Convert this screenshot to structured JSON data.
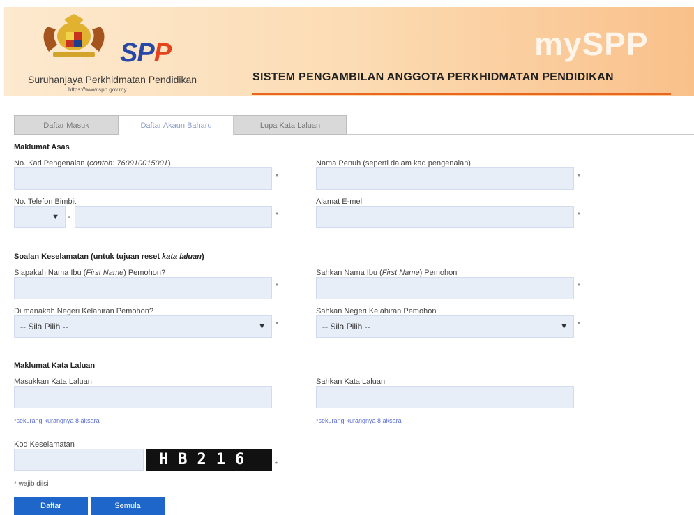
{
  "header": {
    "logo_text_a": "SP",
    "logo_text_b": "P",
    "org_name": "Suruhanjaya Perkhidmatan Pendidikan",
    "org_url": "https://www.spp.gov.my",
    "app_name": "mySPP",
    "system_title": "SISTEM PENGAMBILAN ANGGOTA PERKHIDMATAN PENDIDIKAN"
  },
  "tabs": [
    {
      "label": "Daftar Masuk"
    },
    {
      "label": "Daftar Akaun Baharu"
    },
    {
      "label": "Lupa Kata Laluan"
    }
  ],
  "basic": {
    "title": "Maklumat Asas",
    "ic_label": "No. Kad Pengenalan (",
    "ic_label_example": "contoh: 760910015001",
    "ic_label_end": ")",
    "fullname_label": "Nama Penuh (seperti dalam kad pengenalan)",
    "phone_label": "No. Telefon Bimbit",
    "phone_dash": "-",
    "email_label": "Alamat E-mel"
  },
  "security": {
    "title_a": "Soalan Keselamatan (untuk tujuan reset ",
    "title_b": "kata laluan",
    "title_c": ")",
    "mother_label_a": "Siapakah Nama Ibu (",
    "mother_label_b": "First Name",
    "mother_label_c": ") Pemohon?",
    "mother_confirm_a": "Sahkan Nama Ibu (",
    "mother_confirm_b": "First Name",
    "mother_confirm_c": ") Pemohon",
    "state_label": "Di manakah Negeri Kelahiran Pemohon?",
    "state_confirm_label": "Sahkan Negeri Kelahiran Pemohon",
    "state_select": "-- Sila Pilih --",
    "state_confirm_select": "-- Sila Pilih --"
  },
  "password": {
    "title": "Maklumat Kata Laluan",
    "pw_label": "Masukkan Kata Laluan",
    "pw_confirm_label": "Sahkan Kata Laluan",
    "hint": "*sekurang-kurangnya 8 aksara",
    "hint_confirm": "*sekurang-kurangnya 8 aksara",
    "captcha_label": "Kod Keselamatan",
    "captcha_code": "HB216",
    "required_note": "* wajib diisi"
  },
  "req_mark": "*",
  "buttons": {
    "register": "Daftar",
    "reset": "Semula"
  }
}
